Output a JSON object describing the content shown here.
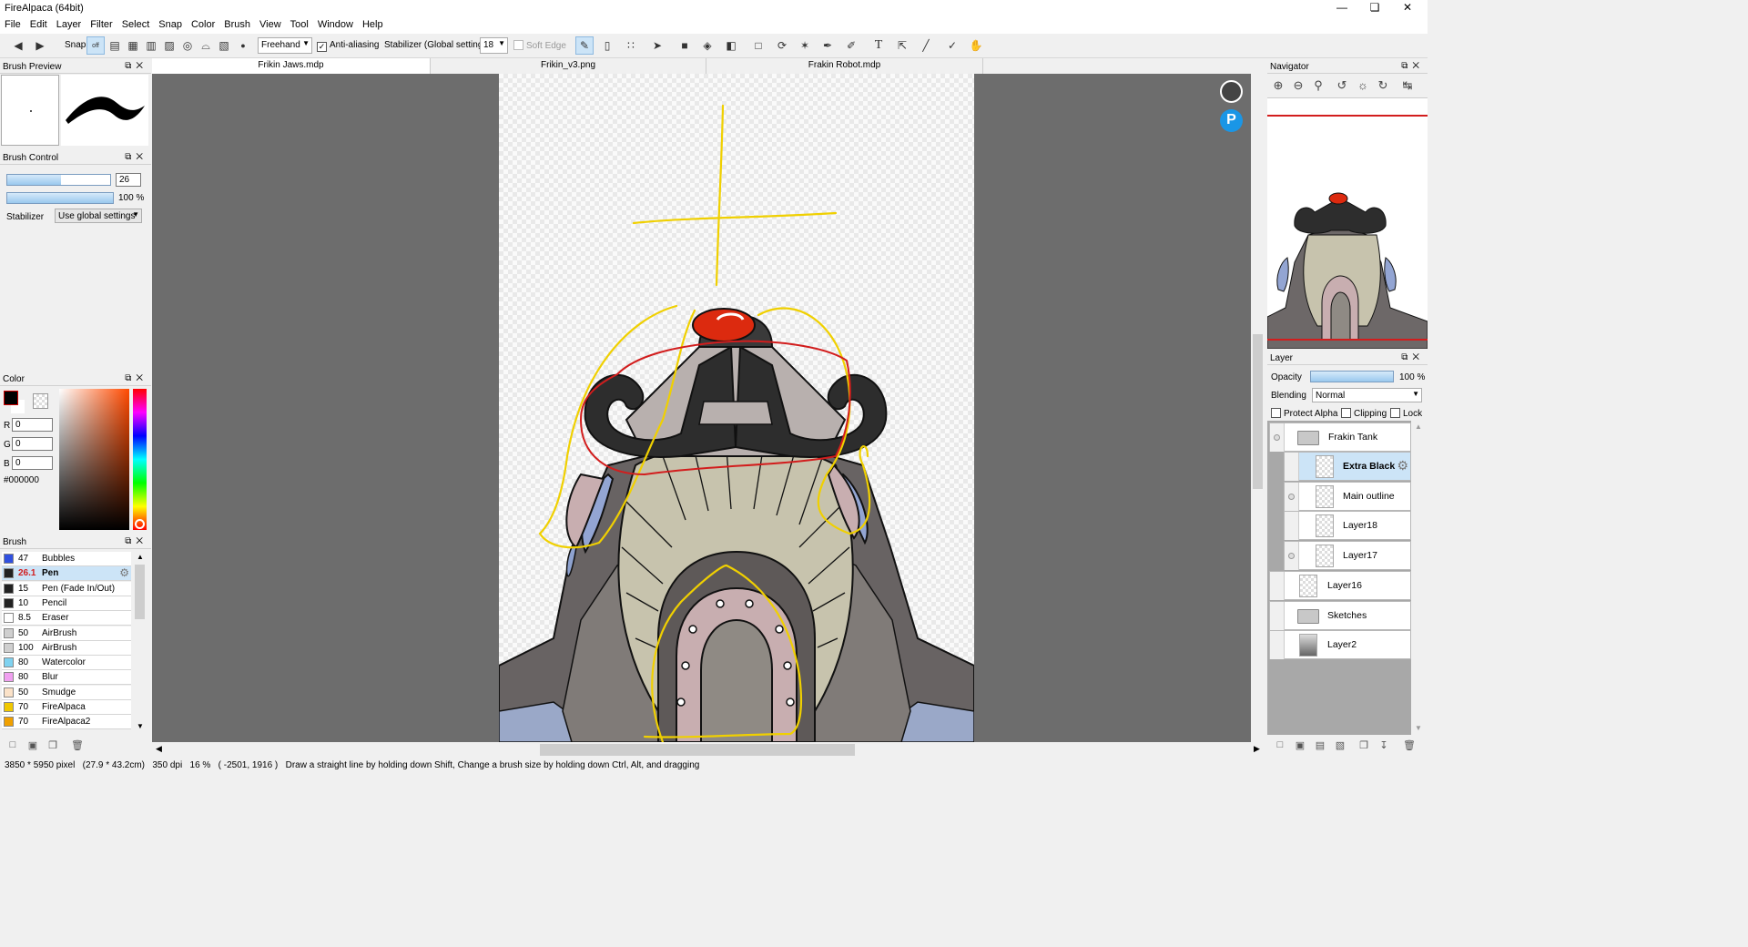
{
  "app": {
    "title": "FireAlpaca (64bit)"
  },
  "menu": [
    "File",
    "Edit",
    "Layer",
    "Filter",
    "Select",
    "Snap",
    "Color",
    "Brush",
    "View",
    "Tool",
    "Window",
    "Help"
  ],
  "toolbar": {
    "snap_label": "Snap",
    "snap_off": "off",
    "mode_value": "Freehand",
    "antialias_label": "Anti-aliasing",
    "stabilizer_label": "Stabilizer (Global settings)",
    "stabilizer_value": "18",
    "softedge_label": "Soft Edge"
  },
  "tabs": [
    "Frikin Jaws.mdp",
    "Frikin_v3.png",
    "Frakin Robot.mdp"
  ],
  "panels": {
    "brush_preview": "Brush Preview",
    "brush_control": "Brush Control",
    "color": "Color",
    "brush": "Brush",
    "navigator": "Navigator",
    "layer": "Layer"
  },
  "brush_control": {
    "size_value": "26",
    "opacity_value": "100 %",
    "opacity_fraction": 1.0,
    "size_fraction": 0.52,
    "stabilizer_label": "Stabilizer",
    "stabilizer_value": "Use global settings"
  },
  "color": {
    "r_label": "R",
    "r": "0",
    "g_label": "G",
    "g": "0",
    "b_label": "B",
    "b": "0",
    "hex": "#000000"
  },
  "brushes": [
    {
      "size": "47",
      "name": "Bubbles",
      "color": "#3050e0"
    },
    {
      "size": "26.1",
      "name": "Pen",
      "color": "#222222",
      "selected": true
    },
    {
      "size": "15",
      "name": "Pen (Fade In/Out)",
      "color": "#222222"
    },
    {
      "size": "10",
      "name": "Pencil",
      "color": "#222222"
    },
    {
      "size": "8.5",
      "name": "Eraser",
      "color": "#ffffff"
    },
    {
      "size": "50",
      "name": "AirBrush",
      "color": "#cfcfcf"
    },
    {
      "size": "100",
      "name": "AirBrush",
      "color": "#cfcfcf"
    },
    {
      "size": "80",
      "name": "Watercolor",
      "color": "#7fd2f0"
    },
    {
      "size": "80",
      "name": "Blur",
      "color": "#f0a0f0"
    },
    {
      "size": "50",
      "name": "Smudge",
      "color": "#fbe2c8"
    },
    {
      "size": "70",
      "name": "FireAlpaca",
      "color": "#f0c800"
    },
    {
      "size": "70",
      "name": "FireAlpaca2",
      "color": "#f0a000"
    }
  ],
  "layer_panel": {
    "opacity_label": "Opacity",
    "opacity_value": "100 %",
    "blending_label": "Blending",
    "blending_value": "Normal",
    "protect_alpha": "Protect Alpha",
    "clipping": "Clipping",
    "lock": "Lock"
  },
  "layers": [
    {
      "name": "Frakin Tank",
      "type": "folder"
    },
    {
      "name": "Extra Black",
      "type": "layer",
      "selected": true
    },
    {
      "name": "Main outline",
      "type": "layer"
    },
    {
      "name": "Layer18",
      "type": "layer"
    },
    {
      "name": "Layer17",
      "type": "layer"
    },
    {
      "name": "Layer16",
      "type": "layer"
    },
    {
      "name": "Sketches",
      "type": "folder"
    },
    {
      "name": "Layer2",
      "type": "layer"
    }
  ],
  "status": {
    "size": "3850 * 5950 pixel",
    "cm": "(27.9 * 43.2cm)",
    "dpi": "350 dpi",
    "zoom": "16 %",
    "coords": "( -2501, 1916 )",
    "hint": "Draw a straight line by holding down Shift, Change a brush size by holding down Ctrl, Alt, and dragging"
  }
}
